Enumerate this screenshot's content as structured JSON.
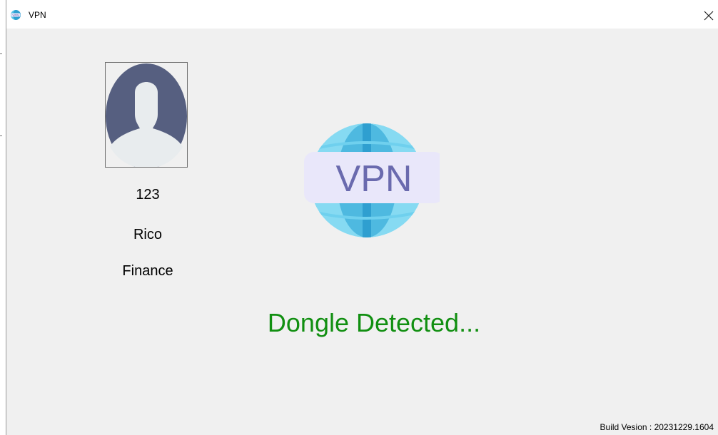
{
  "window": {
    "title": "VPN",
    "close_symbol": "✕"
  },
  "user": {
    "id": "123",
    "name": "Rico",
    "department": "Finance"
  },
  "logo": {
    "text": "VPN"
  },
  "status": {
    "message": "Dongle Detected...",
    "color": "#118f11"
  },
  "build": {
    "label": "Build Vesion :",
    "version": "20231229.1604"
  },
  "icons": {
    "app": "vpn-globe-icon",
    "close": "close-icon",
    "avatar": "user-silhouette-icon"
  }
}
